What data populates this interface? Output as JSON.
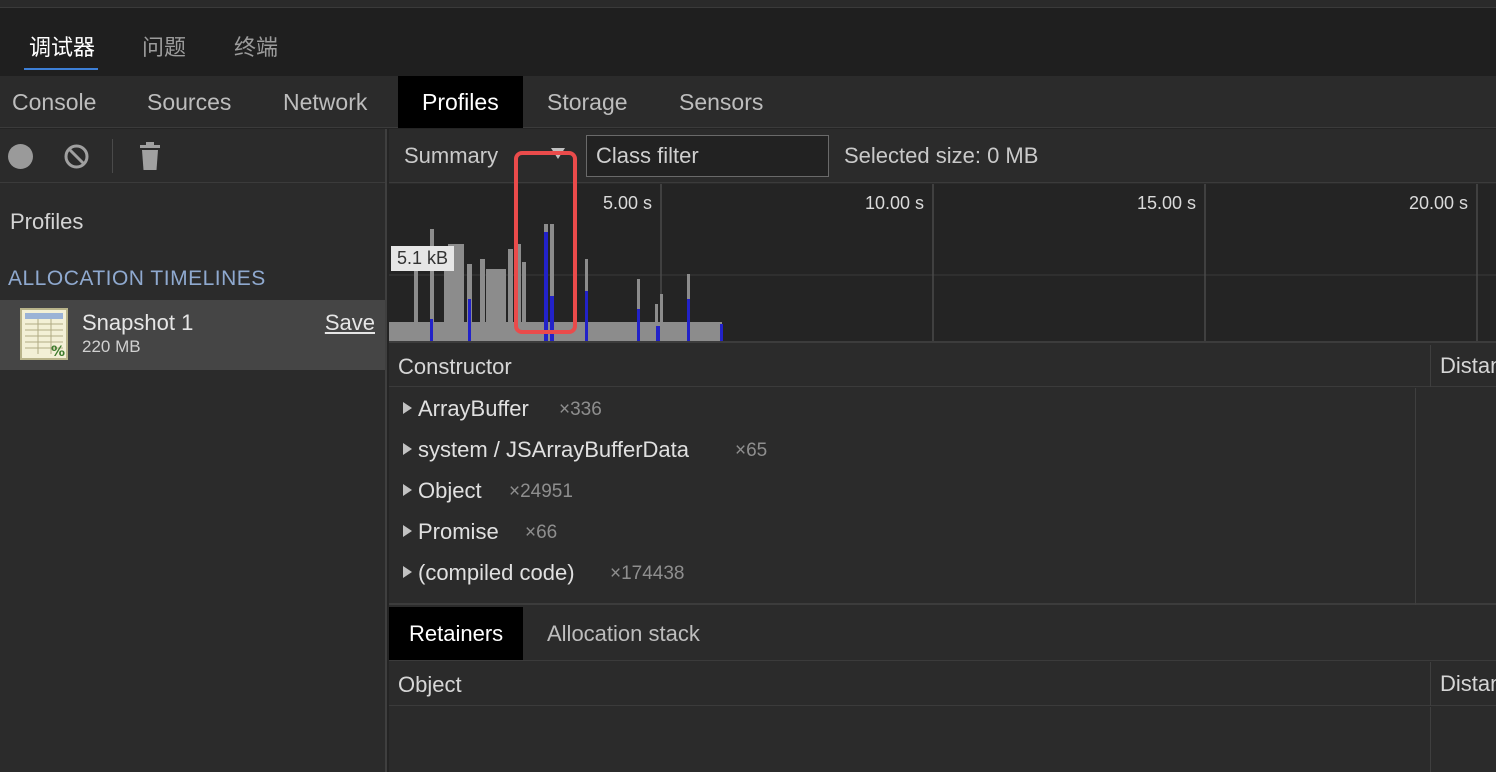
{
  "top_tabs": [
    {
      "label": "调试器",
      "active": true
    },
    {
      "label": "问题",
      "active": false
    },
    {
      "label": "终端",
      "active": false
    }
  ],
  "panel_tabs": [
    {
      "label": "Console",
      "active": false
    },
    {
      "label": "Sources",
      "active": false
    },
    {
      "label": "Network",
      "active": false
    },
    {
      "label": "Profiles",
      "active": true
    },
    {
      "label": "Storage",
      "active": false
    },
    {
      "label": "Sensors",
      "active": false
    }
  ],
  "sidebar": {
    "toolbar_icons": [
      "record-icon",
      "clear-icon",
      "trash-icon"
    ],
    "title": "Profiles",
    "section": "ALLOCATION TIMELINES",
    "snapshot": {
      "name": "Snapshot 1",
      "size": "220 MB",
      "save_label": "Save",
      "icon": "spreadsheet-icon"
    }
  },
  "toolbar": {
    "view": "Summary",
    "class_filter_placeholder": "Class filter",
    "selected_size": "Selected size: 0 MB"
  },
  "timeline": {
    "tick_labels": [
      "5.00 s",
      "10.00 s",
      "15.00 s",
      "20.00 s"
    ],
    "max_label": "5.1 kB",
    "colors": {
      "allocated": "#8c8c8c",
      "live": "#2222c8",
      "highlight": "#ea4b4b"
    }
  },
  "constructor_grid": {
    "col_constructor": "Constructor",
    "col_distance": "Distance",
    "rows": [
      {
        "name": "ArrayBuffer",
        "count": "×336"
      },
      {
        "name": "system / JSArrayBufferData",
        "count": "×65"
      },
      {
        "name": "Object",
        "count": "×24951"
      },
      {
        "name": "Promise",
        "count": "×66"
      },
      {
        "name": "(compiled code)",
        "count": "×174438"
      }
    ]
  },
  "bottom": {
    "tabs": [
      {
        "label": "Retainers",
        "active": true
      },
      {
        "label": "Allocation stack",
        "active": false
      }
    ],
    "col_object": "Object",
    "col_distance": "Distance"
  }
}
